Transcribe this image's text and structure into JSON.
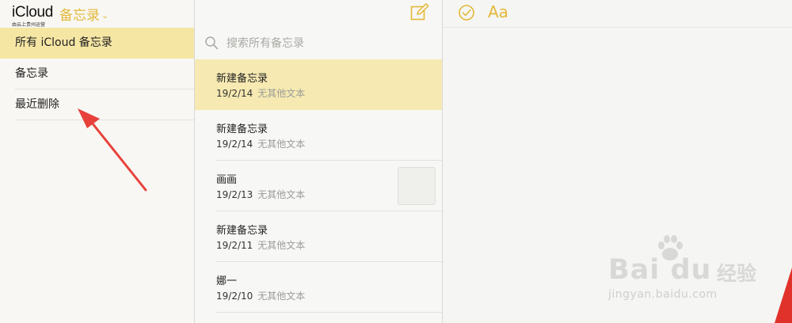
{
  "brand": {
    "name": "iCloud",
    "subtitle": "由云上贵州运营",
    "app_name": "备忘录",
    "app_chevron": "⌄"
  },
  "folders": [
    {
      "label": "所有 iCloud 备忘录",
      "selected": true
    },
    {
      "label": "备忘录",
      "selected": false
    },
    {
      "label": "最近删除",
      "selected": false
    }
  ],
  "search": {
    "placeholder": "搜索所有备忘录",
    "value": ""
  },
  "notes": [
    {
      "title": "新建备忘录",
      "date": "19/2/14",
      "preview": "无其他文本",
      "selected": true
    },
    {
      "title": "新建备忘录",
      "date": "19/2/14",
      "preview": "无其他文本",
      "selected": false
    },
    {
      "title": "画画",
      "date": "19/2/13",
      "preview": "无其他文本",
      "selected": false,
      "has_thumbnail": true
    },
    {
      "title": "新建备忘录",
      "date": "19/2/11",
      "preview": "无其他文本",
      "selected": false
    },
    {
      "title": "娜一",
      "date": "19/2/10",
      "preview": "无其他文本",
      "selected": false
    }
  ],
  "editor": {
    "format_label": "Aa"
  },
  "watermark": {
    "baidu": "Bai du",
    "zh": "经验",
    "url": "jingyan.baidu.com"
  },
  "colors": {
    "accent": "#e3b93a",
    "selection": "#f6e6a4",
    "arrow": "#e8413b"
  },
  "icons": {
    "compose": "compose-icon",
    "search": "search-icon",
    "checklist": "checklist-icon",
    "chevron": "chevron-down-icon"
  }
}
